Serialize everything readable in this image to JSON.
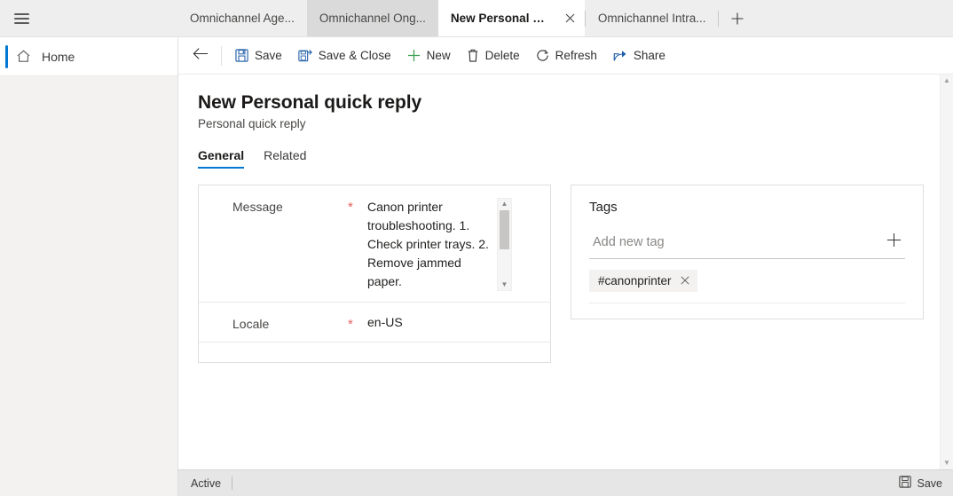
{
  "window": {
    "menu_icon": "hamburger-icon"
  },
  "tabs": {
    "items": [
      {
        "label": "Omnichannel Age...",
        "state": "inactive"
      },
      {
        "label": "Omnichannel Ong...",
        "state": "hovered"
      },
      {
        "label": "New Personal quick reply",
        "state": "active",
        "close_icon": "close-icon"
      },
      {
        "label": "Omnichannel Intra...",
        "state": "inactive"
      }
    ],
    "new_tab_icon": "plus-icon"
  },
  "sidebar": {
    "items": [
      {
        "label": "Home",
        "icon": "home-icon",
        "selected": true
      }
    ]
  },
  "commandbar": {
    "back_icon": "arrow-left-icon",
    "buttons": [
      {
        "label": "Save",
        "icon": "save-floppy-icon"
      },
      {
        "label": "Save & Close",
        "icon": "save-and-close-icon"
      },
      {
        "label": "New",
        "icon": "plus-icon"
      },
      {
        "label": "Delete",
        "icon": "trash-icon"
      },
      {
        "label": "Refresh",
        "icon": "refresh-icon"
      },
      {
        "label": "Share",
        "icon": "share-icon"
      }
    ]
  },
  "page": {
    "title": "New Personal quick reply",
    "subtitle": "Personal quick reply",
    "form_tabs": [
      {
        "label": "General",
        "selected": true
      },
      {
        "label": "Related",
        "selected": false
      }
    ]
  },
  "form": {
    "fields": [
      {
        "label": "Message",
        "required_marker": "*",
        "value": "Canon printer troubleshooting.\n1. Check printer trays.\n2. Remove jammed paper."
      },
      {
        "label": "Locale",
        "required_marker": "*",
        "value": "en-US"
      }
    ]
  },
  "tags_panel": {
    "title": "Tags",
    "input_placeholder": "Add new tag",
    "input_value": "",
    "add_icon": "plus-icon",
    "chips": [
      {
        "label": "#canonprinter",
        "remove_icon": "close-icon"
      }
    ]
  },
  "statusbar": {
    "state_label": "Active",
    "save_label": "Save",
    "save_icon": "save-floppy-icon"
  },
  "colors": {
    "accent": "#0078d4",
    "required": "#e8605d",
    "tabstrip_bg": "#eeeeee",
    "statusbar_bg": "#e6e6e6"
  }
}
